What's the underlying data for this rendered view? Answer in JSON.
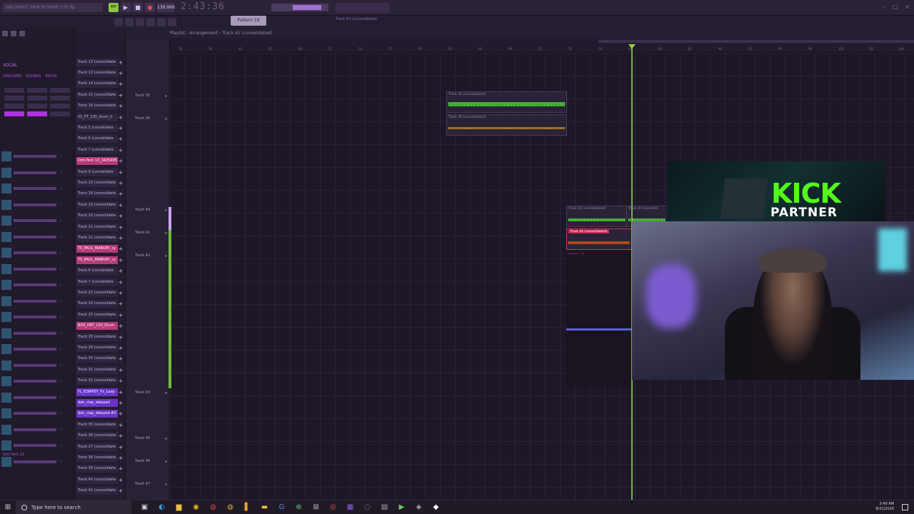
{
  "app": {
    "project_title": "VALORANT SKIN REVAMP 130.flp",
    "tempo": "130.000",
    "time": "2:43:36",
    "pattern": "Pattern 19",
    "hint": "Track 40 (consolidated)",
    "playlist_title": "Playlist - Arrangement › Track 41 (consolidated)"
  },
  "browser": {
    "tag": "VOCAL",
    "tabs": [
      "DISCOVER",
      "SOUNDS",
      "PACKS"
    ],
    "bottom_label": "Drill Perc 13"
  },
  "channels": [
    "Track 13 (consolidate",
    "Track 13 (consolidate",
    "Track 14 (consolidate",
    "Track 15 (consolidate",
    "Track 16 (consolidate",
    "05_PT_130_drum_li",
    "Track 5 (consolidate",
    "Track 6 (consolidate",
    "Track 7 (consolidate",
    "Drill Perc 13_3425495",
    "Track 9 (consolidate",
    "Track 10 (consolidate",
    "Track 18 (consolidate",
    "Track 19 (consolidate",
    "Track 20 (consolidate",
    "Track 21 (consolidate",
    "Track 22 (consolidate",
    "TS_PAUL_MABURY_cy",
    "TS_PAUL_MABURY_cy",
    "Track 6 (consolidate",
    "Track 7 (consolidate",
    "Track 23 (consolidate",
    "Track 24 (consolidate",
    "Track 25 (consolidate",
    "BOS_HIIT_130_Drum",
    "Track 28 (consolidate",
    "Track 29 (consolidate",
    "Track 30 (consolidate",
    "Track 31 (consolidate",
    "Track 32 (consolidate",
    "FL_EDMPSY_Fx_Loop",
    "dah_clap_delayed",
    "dah_clap_delayed #2",
    "Track 35 (consolidate",
    "Track 36 (consolidate",
    "Track 37 (consolidate",
    "Track 38 (consolidate",
    "Track 39 (consolidate",
    "Track 40 (consolidate",
    "Track 41 (consolidate"
  ],
  "channel_highlight": {
    "pink": [
      9,
      17,
      18,
      24
    ],
    "blue": [
      30,
      31,
      32
    ]
  },
  "tracks": [
    {
      "label": "Track 35"
    },
    {
      "label": "Track 36"
    },
    {
      "label": "Track 40"
    },
    {
      "label": "Track 41"
    },
    {
      "label": "Track 42"
    },
    {
      "label": "Track 43"
    },
    {
      "label": "Track 45"
    },
    {
      "label": "Track 46"
    },
    {
      "label": "Track 47"
    }
  ],
  "clips": {
    "c35": "Track 35 (consolidated)",
    "c36": "Track 36 (consolidated)",
    "c40a": "Track 40 (consolidated)",
    "c40b": "Track 40 (consolid",
    "c41": "Track 41 (consolidated)",
    "pattern": "Pattern 19"
  },
  "ruler_ticks": [
    "36",
    "39",
    "42",
    "45",
    "48",
    "51",
    "54",
    "57",
    "60",
    "63",
    "66",
    "69",
    "72",
    "75",
    "78",
    "81",
    "84",
    "87",
    "90",
    "93",
    "96",
    "99",
    "102",
    "105",
    "108"
  ],
  "overlay": {
    "kick_title": "KICK",
    "kick_sub": "PARTNER"
  },
  "taskbar": {
    "search_placeholder": "Type here to search",
    "time": "3:49 AM",
    "date": "8/21/2026"
  },
  "colors": {
    "accent": "#b030e0",
    "kick_green": "#53fc18",
    "playhead": "#6fbb3a"
  }
}
